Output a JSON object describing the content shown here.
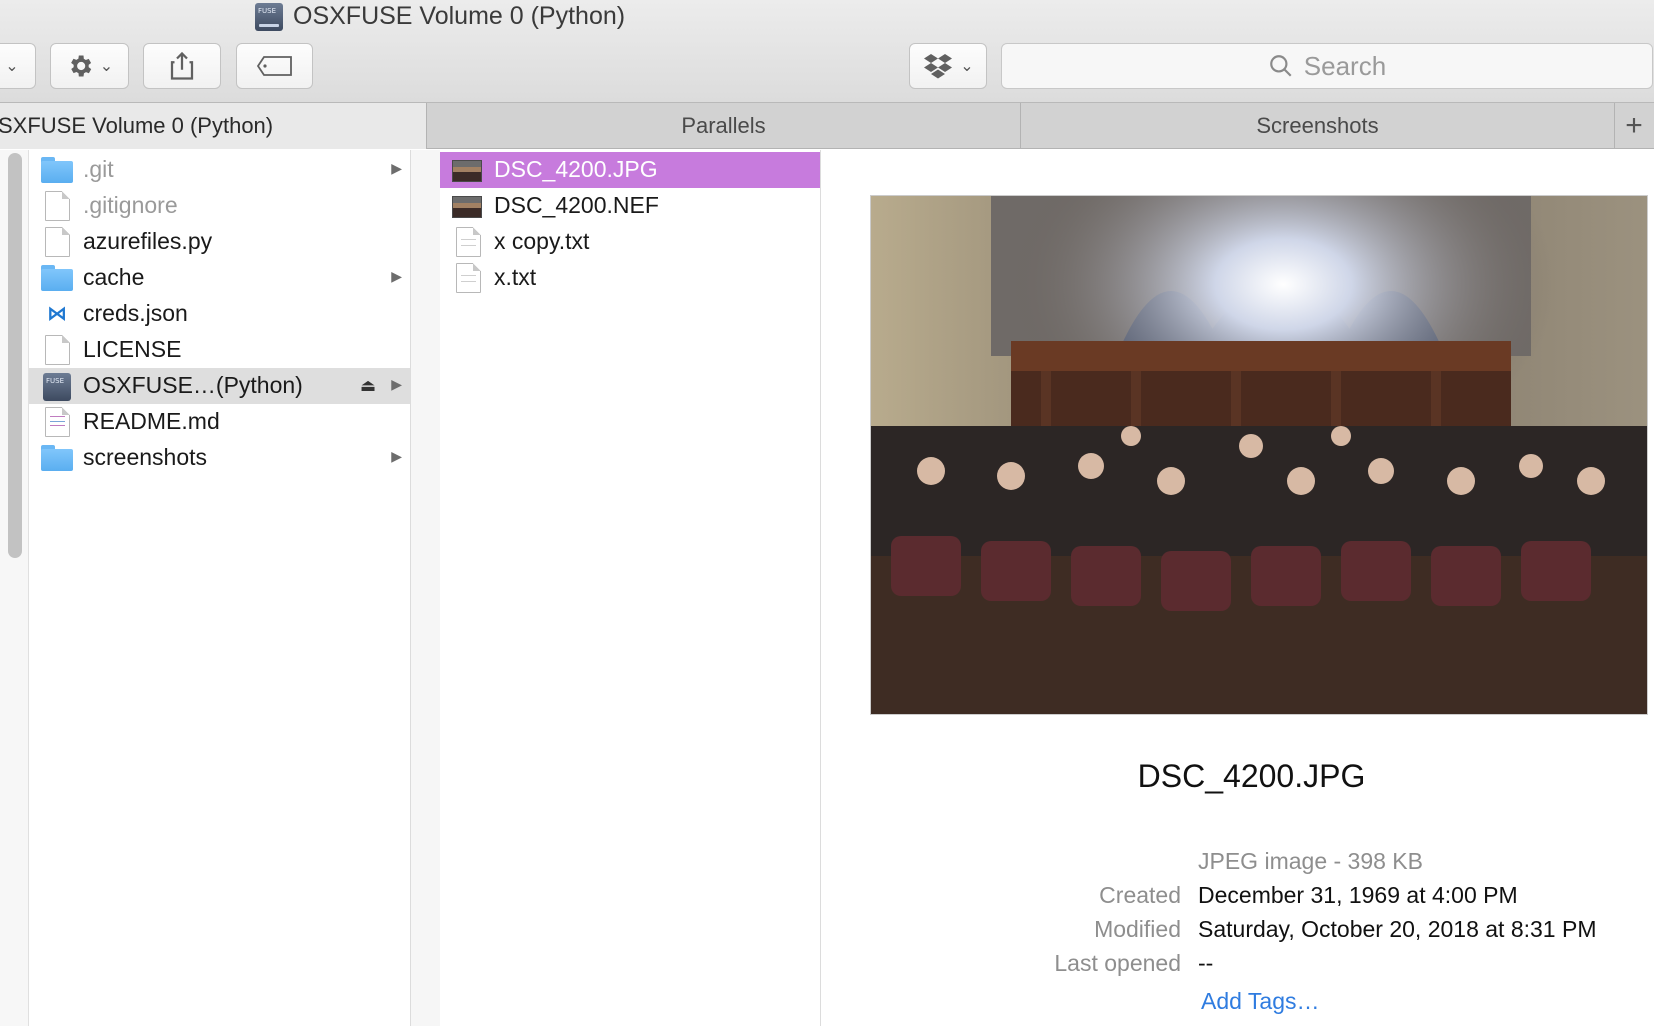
{
  "window": {
    "title": "OSXFUSE Volume 0 (Python)"
  },
  "toolbar": {
    "view_menu_icon": "chevron-down-icon",
    "action_icon": "gear-icon",
    "share_icon": "share-icon",
    "tag_icon": "tag-icon",
    "dropbox_icon": "dropbox-icon",
    "search_placeholder": "Search"
  },
  "tabs": [
    {
      "label": "SXFUSE Volume 0 (Python)",
      "active": true
    },
    {
      "label": "Parallels",
      "active": false
    },
    {
      "label": "Screenshots",
      "active": false
    }
  ],
  "column1": {
    "items": [
      {
        "name": ".git",
        "icon": "folder-icon",
        "dim": true,
        "arrow": true
      },
      {
        "name": ".gitignore",
        "icon": "document-icon",
        "dim": true,
        "arrow": false
      },
      {
        "name": "azurefiles.py",
        "icon": "document-icon",
        "dim": false,
        "arrow": false
      },
      {
        "name": "cache",
        "icon": "folder-icon",
        "dim": false,
        "arrow": true
      },
      {
        "name": "creds.json",
        "icon": "vscode-icon",
        "dim": false,
        "arrow": false
      },
      {
        "name": "LICENSE",
        "icon": "document-icon",
        "dim": false,
        "arrow": false
      },
      {
        "name": "OSXFUSE…(Python)",
        "icon": "drive-icon",
        "dim": false,
        "arrow": true,
        "eject": true
      },
      {
        "name": "README.md",
        "icon": "markdown-icon",
        "dim": false,
        "arrow": false
      },
      {
        "name": "screenshots",
        "icon": "folder-icon",
        "dim": false,
        "arrow": true
      }
    ]
  },
  "column2": {
    "items": [
      {
        "name": "DSC_4200.JPG",
        "icon": "image-thumbnail-icon",
        "selected": true
      },
      {
        "name": "DSC_4200.NEF",
        "icon": "image-thumbnail-icon",
        "selected": false
      },
      {
        "name": "x copy.txt",
        "icon": "text-file-icon",
        "selected": false
      },
      {
        "name": "x.txt",
        "icon": "text-file-icon",
        "selected": false
      }
    ]
  },
  "preview": {
    "file_name": "DSC_4200.JPG",
    "kind": "JPEG image - 398 KB",
    "created_label": "Created",
    "created_value": "December 31, 1969 at 4:00 PM",
    "modified_label": "Modified",
    "modified_value": "Saturday, October 20, 2018 at 8:31 PM",
    "opened_label": "Last opened",
    "opened_value": "--",
    "add_tags": "Add Tags…"
  },
  "colors": {
    "selection": "#c77bdd",
    "link": "#2f7ce0",
    "folder": "#6ab7f4"
  }
}
